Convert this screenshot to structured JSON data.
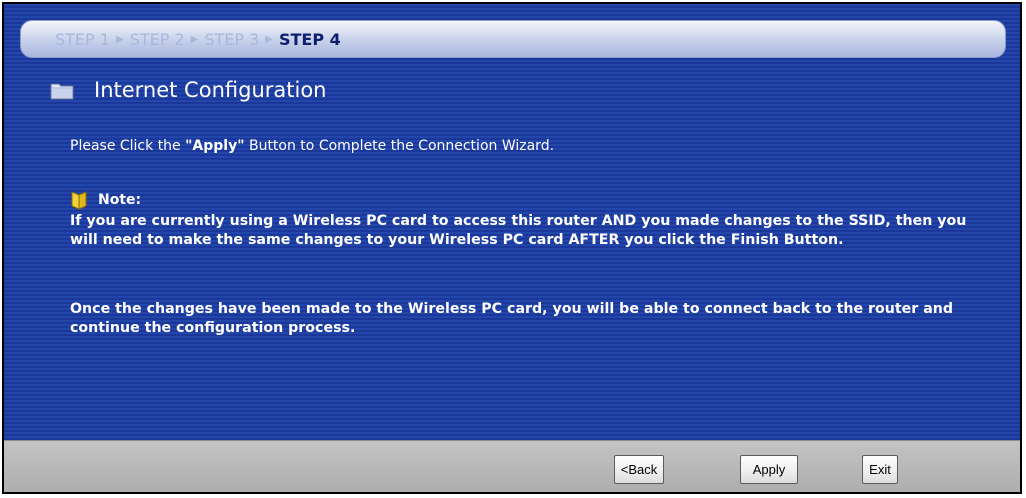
{
  "wizard": {
    "steps": [
      {
        "label": "STEP 1",
        "active": false
      },
      {
        "label": "STEP 2",
        "active": false
      },
      {
        "label": "STEP 3",
        "active": false
      },
      {
        "label": "STEP 4",
        "active": true
      }
    ],
    "step_separator": "▶"
  },
  "page": {
    "title": "Internet Configuration",
    "instruction_prefix": "Please Click the ",
    "instruction_emphasis": "\"Apply\"",
    "instruction_suffix": " Button to Complete the Connection Wizard."
  },
  "note": {
    "label": "Note:",
    "paragraph1": "If you are currently using a Wireless PC card to access this router AND you made changes to the SSID, then you will need to make the same changes to your Wireless PC card AFTER you click the Finish Button.",
    "paragraph2": "Once the changes have been made to the Wireless PC card, you will be able to connect back to the router and continue the configuration process."
  },
  "buttons": {
    "back": "<Back",
    "apply": "Apply",
    "exit": "Exit"
  },
  "icons": {
    "title": "folder-icon",
    "note": "note-icon"
  },
  "colors": {
    "panel_background": "#1d3d9c",
    "active_step": "#0b1f6e",
    "inactive_step": "#aab7d9",
    "footer": "#b8b8b8"
  }
}
